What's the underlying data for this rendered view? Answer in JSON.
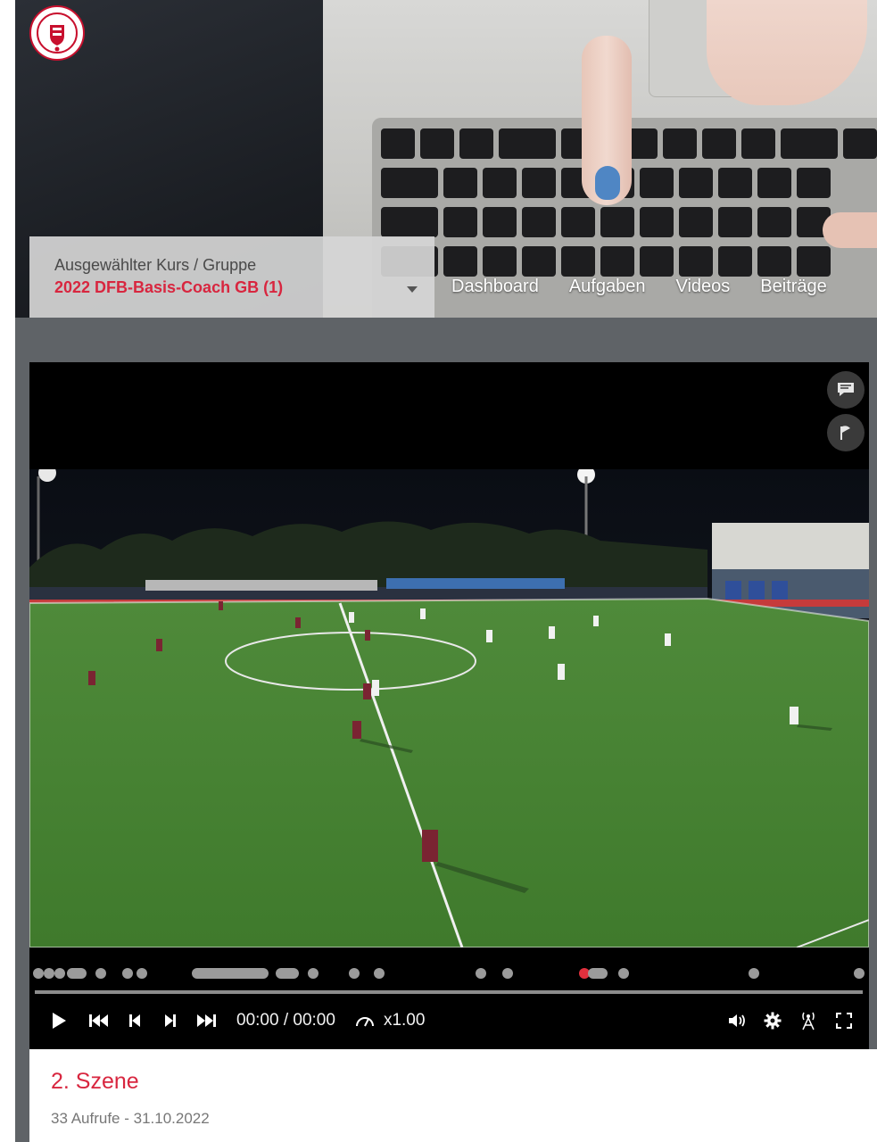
{
  "header": {
    "logo_icon": "hessian-lion-crest-icon",
    "course_selector": {
      "label": "Ausgewählter Kurs / Gruppe",
      "value": "2022 DFB-Basis-Coach GB (1)"
    },
    "nav": [
      {
        "label": "Dashboard"
      },
      {
        "label": "Aufgaben"
      },
      {
        "label": "Videos"
      },
      {
        "label": "Beiträge"
      }
    ]
  },
  "player": {
    "side_buttons": [
      "comment-icon",
      "flag-icon"
    ],
    "controls": {
      "time": "00:00 / 00:00",
      "speed": "x1.00",
      "progress": 0
    },
    "icons": [
      "play-icon",
      "skip-start-icon",
      "previous-icon",
      "next-icon",
      "skip-end-icon",
      "speedometer-icon",
      "volume-icon",
      "settings-gear-icon",
      "broadcast-icon",
      "fullscreen-icon"
    ]
  },
  "video_info": {
    "title": "2. Szene",
    "meta": "33 Aufrufe - 31.10.2022"
  },
  "colors": {
    "accent": "#d8263f",
    "page_bg": "#5f6367",
    "player_bg": "#000000"
  }
}
